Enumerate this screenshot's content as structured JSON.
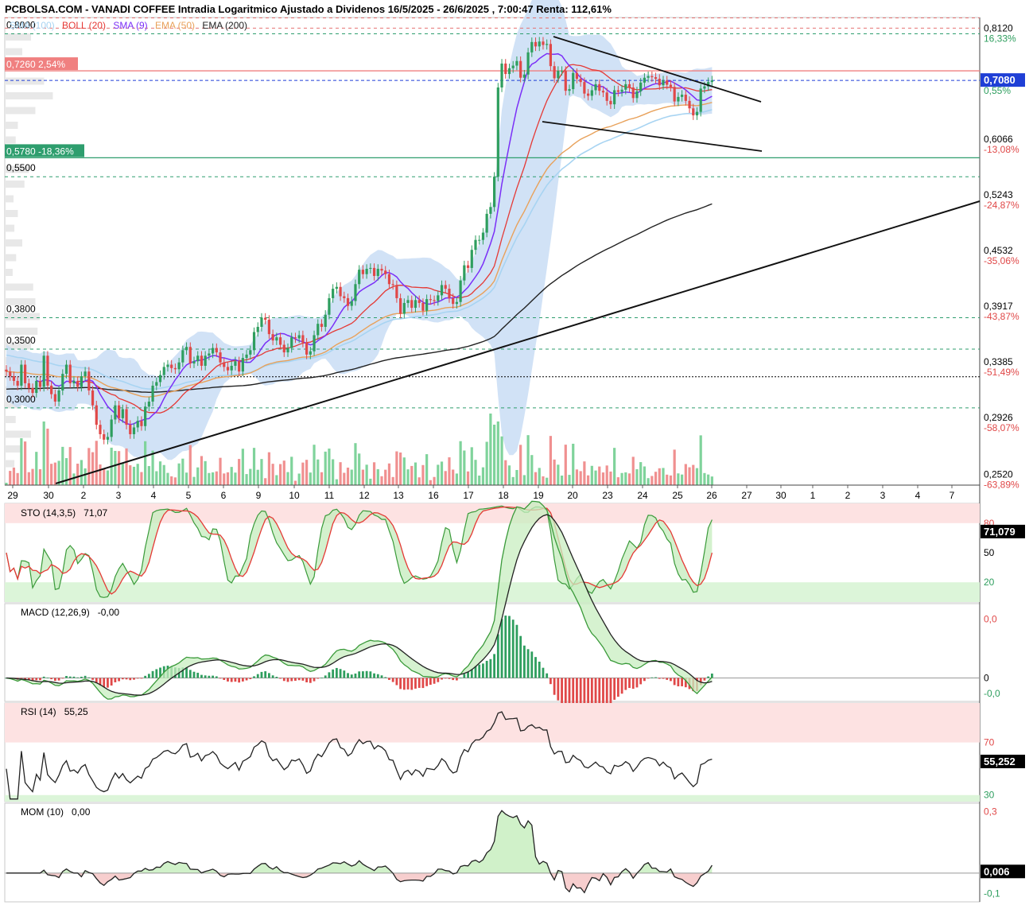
{
  "header": {
    "title": "PCBOLSA.COM - VANADI COFFEE Intradia Logaritmico Ajustado a Dividenos 16/5/2025 - 26/6/2025 , 7:00:47 Renta: 112,61%"
  },
  "legend": [
    {
      "label": "SMA (100)",
      "color": "#a8d4f2"
    },
    {
      "label": "BOLL (20)",
      "color": "#e53935"
    },
    {
      "label": "SMA (9)",
      "color": "#7b2ff7"
    },
    {
      "label": "EMA (50)",
      "color": "#e8a15a"
    },
    {
      "label": "EMA (200)",
      "color": "#222222"
    }
  ],
  "colors": {
    "up": "#2e9e5e",
    "down": "#e04848",
    "boll_fill": "#c9ddf5",
    "sma100": "#a8d4f2",
    "boll_mid": "#e53935",
    "sma9": "#7b2ff7",
    "ema50": "#e8a15a",
    "ema200": "#222222",
    "resistance_line": "#f08080",
    "support_line": "#2e9e6e",
    "current_line": "#1f3fd6"
  },
  "chart_data": [
    {
      "type": "candlestick",
      "title": "VANADI COFFEE",
      "scale": "log",
      "ylim": [
        0.245,
        0.835
      ],
      "x_dates": [
        "29",
        "30",
        "2",
        "3",
        "4",
        "5",
        "6",
        "9",
        "10",
        "11",
        "12",
        "13",
        "16",
        "17",
        "18",
        "19",
        "20",
        "23",
        "24",
        "25",
        "26",
        "27",
        "30",
        "1",
        "2",
        "3",
        "4",
        "7"
      ],
      "y_ticks": [
        {
          "value": 0.812,
          "label": "0,8120",
          "pct": "16,33%"
        },
        {
          "value": 0.708,
          "label": "0,7080",
          "pct": "0,55%"
        },
        {
          "value": 0.6066,
          "label": "0,6066",
          "pct": "-13,08%"
        },
        {
          "value": 0.5243,
          "label": "0,5243",
          "pct": "-24,87%"
        },
        {
          "value": 0.4532,
          "label": "0,4532",
          "pct": "-35,06%"
        },
        {
          "value": 0.3917,
          "label": "0,3917",
          "pct": "-43,87%"
        },
        {
          "value": 0.3385,
          "label": "0,3385",
          "pct": "-51,49%"
        },
        {
          "value": 0.2926,
          "label": "0,2926",
          "pct": "-58,07%"
        },
        {
          "value": 0.252,
          "label": "0,2520",
          "pct": "-63,89%"
        }
      ],
      "level_labels": [
        {
          "value": 0.8,
          "label": "0,8000"
        },
        {
          "value": 0.55,
          "label": "0,5500"
        },
        {
          "value": 0.38,
          "label": "0,3800"
        },
        {
          "value": 0.35,
          "label": "0,3500"
        },
        {
          "value": 0.3,
          "label": "0,3000"
        }
      ],
      "resistance": {
        "value": 0.726,
        "label": "0,7260",
        "pct": "2,54%"
      },
      "support": {
        "value": 0.578,
        "label": "0,5780",
        "pct": "-18,36%"
      },
      "current": {
        "value": 0.708,
        "label": "0,7080"
      },
      "series": [
        {
          "name": "Price",
          "closes": [
            0.33,
            0.326,
            0.322,
            0.318,
            0.336,
            0.32,
            0.316,
            0.312,
            0.322,
            0.317,
            0.344,
            0.318,
            0.311,
            0.305,
            0.314,
            0.328,
            0.336,
            0.32,
            0.322,
            0.317,
            0.326,
            0.33,
            0.314,
            0.302,
            0.287,
            0.28,
            0.276,
            0.278,
            0.291,
            0.302,
            0.292,
            0.299,
            0.287,
            0.28,
            0.285,
            0.29,
            0.286,
            0.301,
            0.305,
            0.318,
            0.321,
            0.327,
            0.334,
            0.336,
            0.333,
            0.332,
            0.338,
            0.349,
            0.352,
            0.337,
            0.339,
            0.344,
            0.335,
            0.344,
            0.346,
            0.351,
            0.347,
            0.338,
            0.334,
            0.331,
            0.335,
            0.339,
            0.33,
            0.342,
            0.345,
            0.349,
            0.366,
            0.371,
            0.38,
            0.378,
            0.364,
            0.358,
            0.361,
            0.354,
            0.347,
            0.351,
            0.361,
            0.36,
            0.363,
            0.356,
            0.345,
            0.348,
            0.363,
            0.374,
            0.371,
            0.383,
            0.4,
            0.41,
            0.412,
            0.402,
            0.4,
            0.392,
            0.397,
            0.415,
            0.431,
            0.426,
            0.432,
            0.433,
            0.424,
            0.432,
            0.43,
            0.426,
            0.415,
            0.414,
            0.4,
            0.384,
            0.395,
            0.398,
            0.39,
            0.398,
            0.395,
            0.387,
            0.399,
            0.398,
            0.397,
            0.403,
            0.414,
            0.41,
            0.4,
            0.394,
            0.396,
            0.419,
            0.436,
            0.433,
            0.454,
            0.466,
            0.466,
            0.475,
            0.499,
            0.508,
            0.55,
            0.695,
            0.74,
            0.72,
            0.731,
            0.736,
            0.745,
            0.713,
            0.719,
            0.762,
            0.783,
            0.774,
            0.784,
            0.777,
            0.779,
            0.735,
            0.712,
            0.726,
            0.726,
            0.689,
            0.692,
            0.722,
            0.711,
            0.705,
            0.684,
            0.68,
            0.69,
            0.701,
            0.689,
            0.686,
            0.671,
            0.665,
            0.69,
            0.687,
            0.691,
            0.701,
            0.695,
            0.676,
            0.688,
            0.704,
            0.713,
            0.716,
            0.714,
            0.711,
            0.699,
            0.708,
            0.7,
            0.696,
            0.67,
            0.678,
            0.682,
            0.671,
            0.658,
            0.646,
            0.652,
            0.693,
            0.697,
            0.705,
            0.708
          ]
        },
        {
          "name": "SMA (9)"
        },
        {
          "name": "BOLL (20)"
        },
        {
          "name": "EMA (50)"
        },
        {
          "name": "SMA (100)"
        },
        {
          "name": "EMA (200)"
        }
      ]
    },
    {
      "type": "line",
      "title": "STO (14,3,5)",
      "value_label": "71,07",
      "value": 71.079,
      "value_text": "71,079",
      "ylim": [
        0,
        100
      ],
      "y_ticks": [
        {
          "value": 80,
          "label": "80"
        },
        {
          "value": 50,
          "label": "50"
        },
        {
          "value": 20,
          "label": "20"
        }
      ]
    },
    {
      "type": "line",
      "title": "MACD (12,26,9)",
      "value_label": "-0,00",
      "y_ticks": [
        {
          "value": 0.03,
          "label": "0,0"
        },
        {
          "value": 0,
          "label": "0"
        },
        {
          "value": -0.008,
          "label": "-0,0"
        }
      ]
    },
    {
      "type": "line",
      "title": "RSI (14)",
      "value_label": "55,25",
      "value": 55.252,
      "value_text": "55,252",
      "ylim": [
        25,
        100
      ],
      "y_ticks": [
        {
          "value": 70,
          "label": "70"
        },
        {
          "value": 30,
          "label": "30"
        }
      ]
    },
    {
      "type": "line",
      "title": "MOM (10)",
      "value_label": "0,00",
      "value": 0.006,
      "value_text": "0,006",
      "y_ticks": [
        {
          "value": 0.3,
          "label": "0,3"
        },
        {
          "value": -0.1,
          "label": "-0,1"
        }
      ]
    }
  ]
}
